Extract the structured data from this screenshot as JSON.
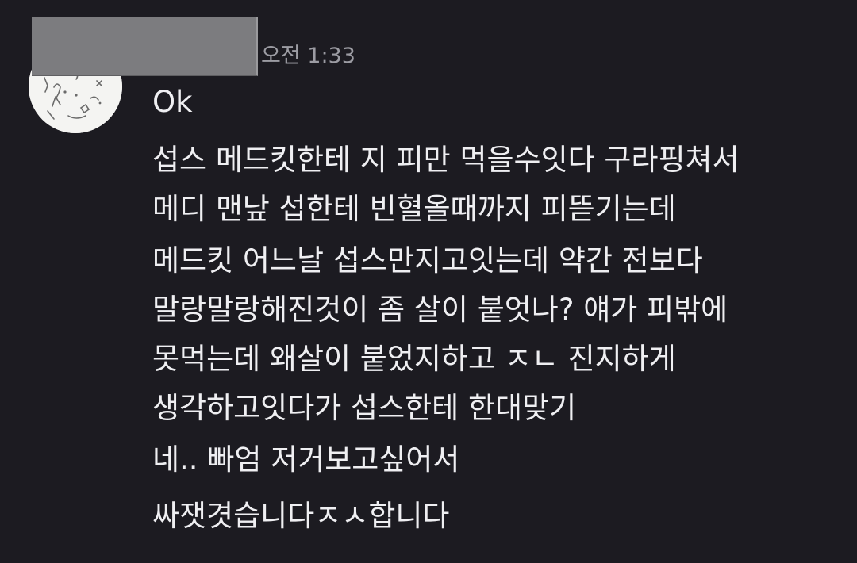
{
  "chat": {
    "timestamp": "오전 1:33",
    "messages": [
      {
        "lines": [
          "Ok"
        ]
      },
      {
        "lines": [
          "섭스 메드킷한테 지 피만 먹을수잇다 구라핑쳐서",
          "메디 맨낲 섭한테 빈혈올때까지 피뜯기는데"
        ]
      },
      {
        "lines": [
          "메드킷 어느날 섭스만지고잇는데 약간 전보다",
          "말랑말랑해진것이 좀 살이 붙엇나? 얘가 피밖에",
          "못먹는데 왜살이 붙었지하고 ㅈㄴ 진지하게",
          "생각하고잇다가 섭스한테 한대맞기"
        ]
      },
      {
        "lines": [
          "네.. 빠엄 저거보고싶어서"
        ]
      },
      {
        "lines": [
          "싸잿겻습니다ㅈㅅ합니다"
        ]
      }
    ]
  },
  "colors": {
    "background": "#1c1b21",
    "text": "#efeff2",
    "timestamp": "#9c9ca3",
    "redaction": "#7c7c7f"
  }
}
